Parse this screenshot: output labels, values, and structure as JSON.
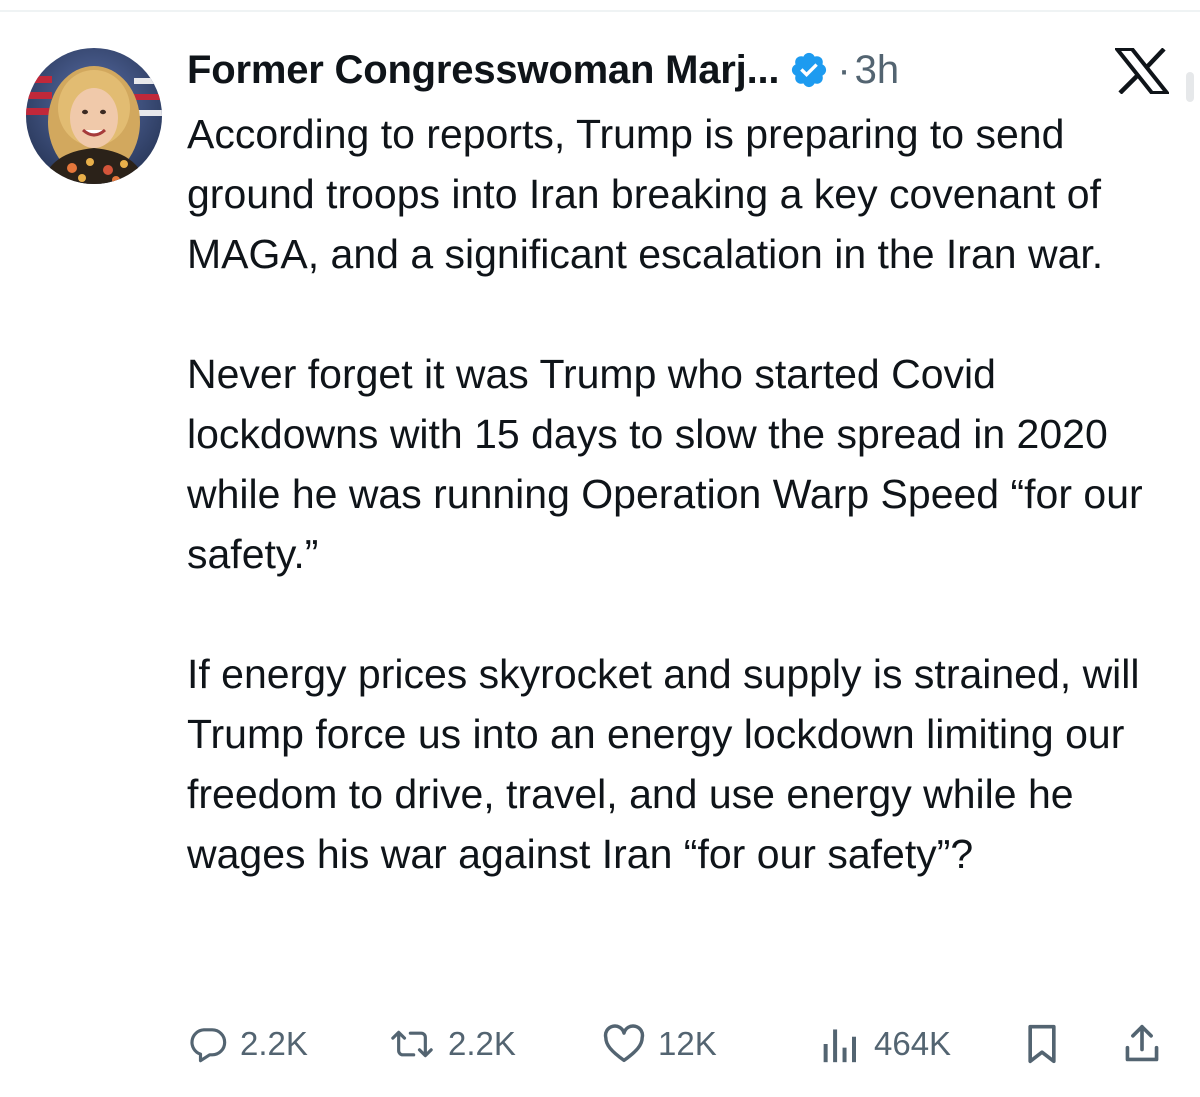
{
  "tweet": {
    "author": {
      "display_name": "Former Congresswoman Marj...",
      "verified_icon": "verified-badge-icon",
      "avatar_icon": "profile-photo"
    },
    "separator": "·",
    "time": "3h",
    "platform_logo": "x-logo-icon",
    "paragraphs": [
      "According to reports, Trump is preparing to send ground troops into Iran breaking a key covenant of MAGA, and a significant escalation in the Iran war.",
      "Never forget it was Trump who started Covid lockdowns with 15 days to slow the spread in 2020 while he was running Operation Warp Speed “for our safety.”",
      "If energy prices skyrocket and supply is strained, will Trump force us into an energy lockdown limiting our freedom to drive, travel, and use energy while he wages his war against Iran “for our safety”?"
    ]
  },
  "actions": {
    "replies": {
      "icon": "reply-icon",
      "count": "2.2K"
    },
    "reposts": {
      "icon": "repost-icon",
      "count": "2.2K"
    },
    "likes": {
      "icon": "heart-icon",
      "count": "12K"
    },
    "views": {
      "icon": "views-chart-icon",
      "count": "464K"
    },
    "bookmark": {
      "icon": "bookmark-icon"
    },
    "share": {
      "icon": "share-icon"
    }
  },
  "colors": {
    "text_primary": "#0f1419",
    "text_secondary": "#536471",
    "verified_blue": "#1d9bf0",
    "divider": "#eff3f4"
  }
}
